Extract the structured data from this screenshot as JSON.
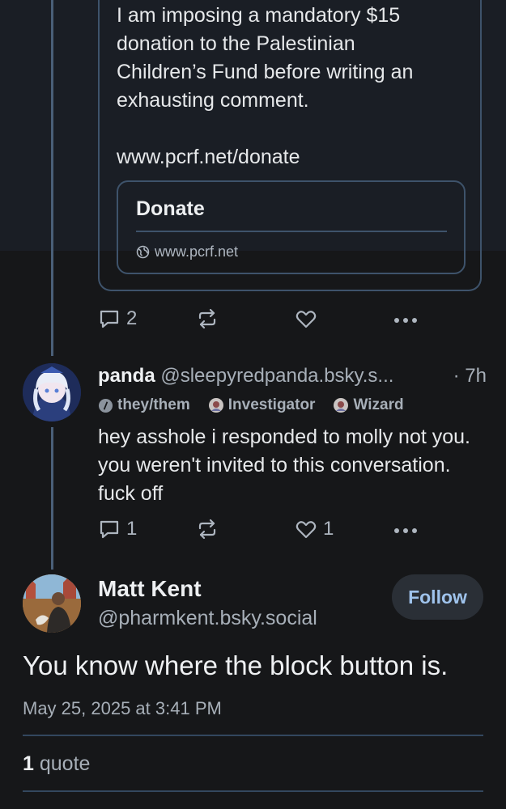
{
  "quoted_post": {
    "text": "I am imposing a mandatory $15\ndonation to the Palestinian\nChildren’s Fund before writing an\nexhausting comment.\n\nwww.pcrf.net/donate",
    "link_card": {
      "title": "Donate",
      "domain": "www.pcrf.net"
    },
    "actions": {
      "reply_count": "2",
      "repost_count": "",
      "like_count": ""
    }
  },
  "reply": {
    "display_name": "panda",
    "handle": "@sleepyredpanda.bsky.s...",
    "time": "· 7h",
    "badges": [
      {
        "label": "they/them",
        "icon": "slash-circle-icon"
      },
      {
        "label": "Investigator",
        "icon": "badge-avatar-icon"
      },
      {
        "label": "Wizard",
        "icon": "badge-avatar-icon"
      }
    ],
    "text": "hey asshole i responded to molly not you. you weren't invited to this conversation. fuck off",
    "actions": {
      "reply_count": "1",
      "repost_count": "",
      "like_count": "1"
    }
  },
  "main_post": {
    "display_name": "Matt Kent",
    "handle": "@pharmkent.bsky.social",
    "follow_label": "Follow",
    "text": "You know where the block button is.",
    "timestamp": "May 25, 2025 at 3:41 PM",
    "quote_count": "1",
    "quote_label": "quote"
  },
  "colors": {
    "background": "#161719",
    "thread_line": "#4a5f78",
    "accent_link": "#9fc3ec",
    "muted_text": "#a7afb8"
  }
}
